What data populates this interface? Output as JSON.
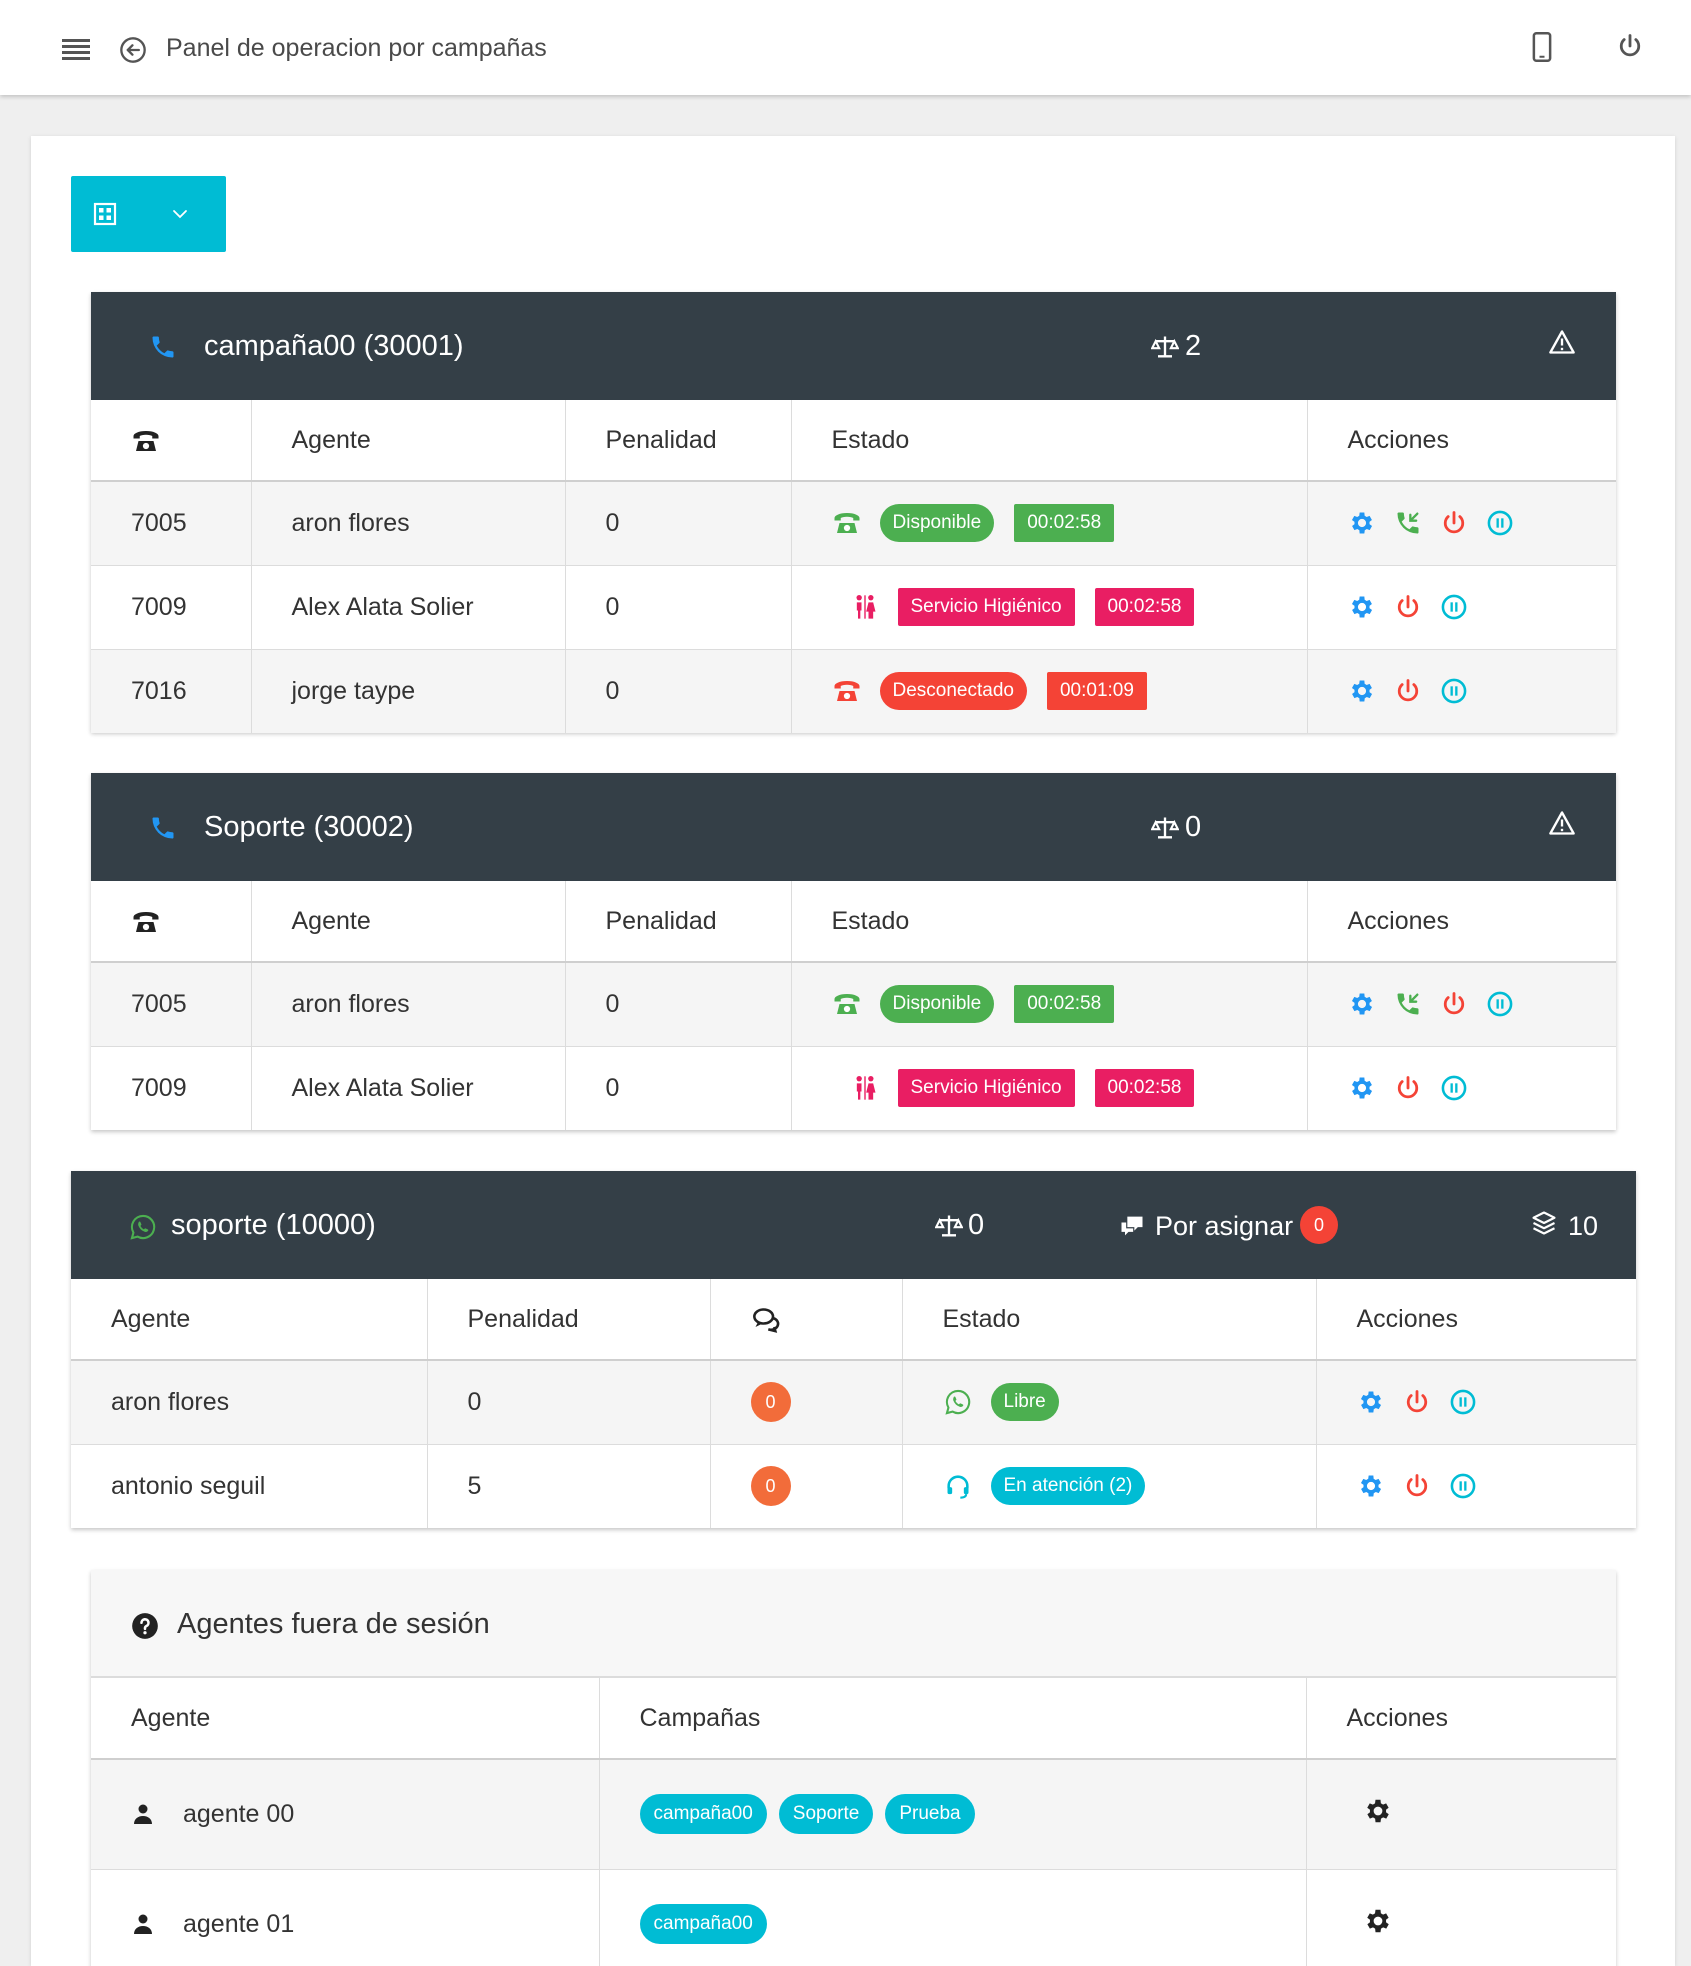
{
  "header": {
    "title": "Panel de operacion por campañas"
  },
  "colors": {
    "green": "#4caf50",
    "pink": "#e91e63",
    "red": "#f44336",
    "cyan": "#00bcd4",
    "blue": "#2196f3",
    "orange": "#f26c3a",
    "dark": "#343f47"
  },
  "campaigns": [
    {
      "title": "campaña00 (30001)",
      "balance": "2",
      "columns": {
        "agent": "Agente",
        "penalty": "Penalidad",
        "state": "Estado",
        "actions": "Acciones"
      },
      "rows": [
        {
          "ext": "7005",
          "agent": "aron flores",
          "penalty": "0",
          "state": "Disponible",
          "time": "00:02:58"
        },
        {
          "ext": "7009",
          "agent": "Alex Alata Solier",
          "penalty": "0",
          "state": "Servicio Higiénico",
          "time": "00:02:58"
        },
        {
          "ext": "7016",
          "agent": "jorge taype",
          "penalty": "0",
          "state": "Desconectado",
          "time": "00:01:09"
        }
      ]
    },
    {
      "title": "Soporte (30002)",
      "balance": "0",
      "columns": {
        "agent": "Agente",
        "penalty": "Penalidad",
        "state": "Estado",
        "actions": "Acciones"
      },
      "rows": [
        {
          "ext": "7005",
          "agent": "aron flores",
          "penalty": "0",
          "state": "Disponible",
          "time": "00:02:58"
        },
        {
          "ext": "7009",
          "agent": "Alex Alata Solier",
          "penalty": "0",
          "state": "Servicio Higiénico",
          "time": "00:02:58"
        }
      ]
    }
  ],
  "whatsapp": {
    "title": "soporte (10000)",
    "balance": "0",
    "unassigned_label": "Por asignar",
    "unassigned_count": "0",
    "layers_count": "10",
    "columns": {
      "agent": "Agente",
      "penalty": "Penalidad",
      "state": "Estado",
      "actions": "Acciones"
    },
    "rows": [
      {
        "agent": "aron flores",
        "penalty": "0",
        "chats": "0",
        "state": "Libre"
      },
      {
        "agent": "antonio seguil",
        "penalty": "5",
        "chats": "0",
        "state": "En atención (2)"
      }
    ]
  },
  "offline": {
    "title": "Agentes fuera de sesión",
    "columns": {
      "agent": "Agente",
      "campaigns": "Campañas",
      "actions": "Acciones"
    },
    "rows": [
      {
        "agent": "agente 00",
        "campaigns": [
          "campaña00",
          "Soporte",
          "Prueba"
        ]
      },
      {
        "agent": "agente 01",
        "campaigns": [
          "campaña00"
        ]
      }
    ]
  }
}
